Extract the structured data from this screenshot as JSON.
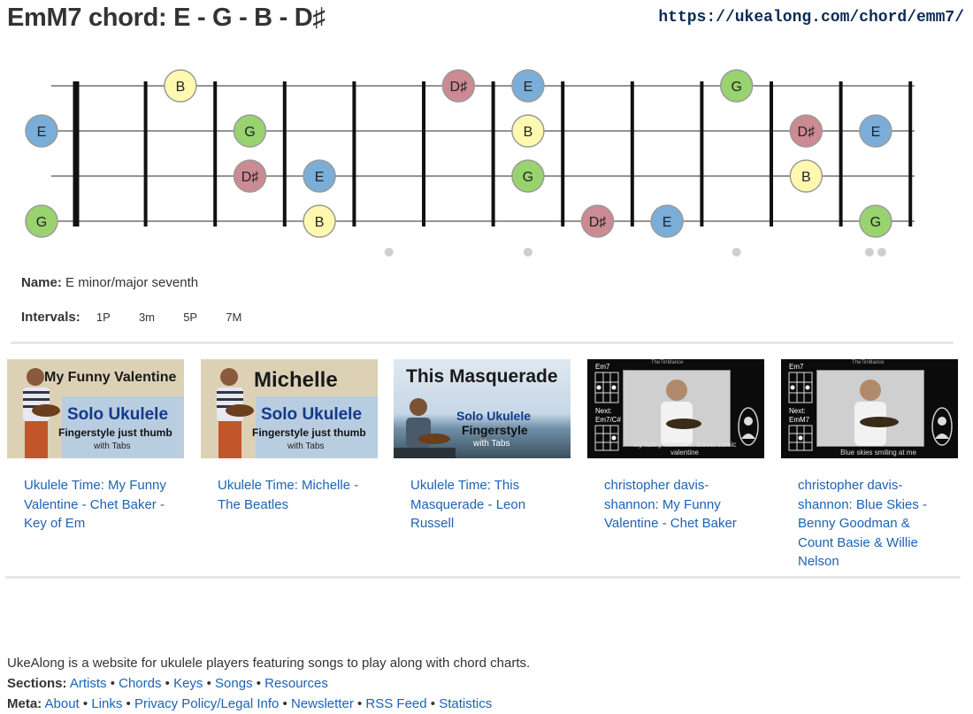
{
  "header": {
    "title": "EmM7 chord: E - G - B - D♯",
    "url": "https://ukealong.com/chord/emm7/"
  },
  "fretboard": {
    "notes": [
      {
        "string": 0,
        "fret": 2,
        "label": "B",
        "color": "#fff9b0"
      },
      {
        "string": 0,
        "fret": 6,
        "label": "D♯",
        "color": "#cc8a92"
      },
      {
        "string": 0,
        "fret": 7,
        "label": "E",
        "color": "#7aaed8"
      },
      {
        "string": 0,
        "fret": 10,
        "label": "G",
        "color": "#99d36f"
      },
      {
        "string": 1,
        "fret": 0,
        "label": "E",
        "color": "#7aaed8"
      },
      {
        "string": 1,
        "fret": 3,
        "label": "G",
        "color": "#99d36f"
      },
      {
        "string": 1,
        "fret": 7,
        "label": "B",
        "color": "#fff9b0"
      },
      {
        "string": 1,
        "fret": 11,
        "label": "D♯",
        "color": "#cc8a92"
      },
      {
        "string": 1,
        "fret": 12,
        "label": "E",
        "color": "#7aaed8"
      },
      {
        "string": 2,
        "fret": 3,
        "label": "D♯",
        "color": "#cc8a92"
      },
      {
        "string": 2,
        "fret": 4,
        "label": "E",
        "color": "#7aaed8"
      },
      {
        "string": 2,
        "fret": 7,
        "label": "G",
        "color": "#99d36f"
      },
      {
        "string": 2,
        "fret": 11,
        "label": "B",
        "color": "#fff9b0"
      },
      {
        "string": 3,
        "fret": 0,
        "label": "G",
        "color": "#99d36f"
      },
      {
        "string": 3,
        "fret": 4,
        "label": "B",
        "color": "#fff9b0"
      },
      {
        "string": 3,
        "fret": 8,
        "label": "D♯",
        "color": "#cc8a92"
      },
      {
        "string": 3,
        "fret": 9,
        "label": "E",
        "color": "#7aaed8"
      },
      {
        "string": 3,
        "fret": 12,
        "label": "G",
        "color": "#99d36f"
      }
    ],
    "markers": [
      5,
      7,
      10
    ],
    "double_marker": 12
  },
  "info": {
    "name_label": "Name:",
    "name_value": "E minor/major seventh",
    "intervals_label": "Intervals:",
    "intervals": [
      "1P",
      "3m",
      "5P",
      "7M"
    ]
  },
  "videos": [
    {
      "link": "Ukulele Time: My Funny Valentine - Chet Baker - Key of Em",
      "thumb_title": "My Funny Valentine",
      "solo": "Solo Ukulele",
      "sub": "Fingerstyle just thumb",
      "tabs": "with Tabs"
    },
    {
      "link": "Ukulele Time: Michelle - The Beatles",
      "thumb_title": "Michelle",
      "solo": "Solo Ukulele",
      "sub": "Fingerstyle just thumb",
      "tabs": "with Tabs"
    },
    {
      "link": "Ukulele Time: This Masquerade - Leon Russell",
      "thumb_title": "This Masquerade",
      "solo": "Solo Ukulele",
      "sub": "Fingerstyle",
      "tabs": "with Tabs"
    },
    {
      "link": "christopher davis-shannon: My Funny Valentine - Chet Baker",
      "chord_top": "Em7",
      "next": "Next:",
      "chord_bottom": "Em7/C#",
      "caption": "My funny valentine. Sweet comic valentine",
      "brand": "TheTinMance"
    },
    {
      "link": "christopher davis-shannon: Blue Skies - Benny Goodman & Count Basie & Willie Nelson",
      "chord_top": "Em7",
      "next": "Next:",
      "chord_bottom": "EmM7",
      "caption": "Blue skies smiling at me",
      "brand": "TheTinMance"
    }
  ],
  "footer": {
    "about_text": "UkeAlong is a website for ukulele players featuring songs to play along with chord charts.",
    "sections_label": "Sections:",
    "sections": [
      "Artists",
      "Chords",
      "Keys",
      "Songs",
      "Resources"
    ],
    "meta_label": "Meta:",
    "meta": [
      "About",
      "Links",
      "Privacy Policy/Legal Info",
      "Newsletter",
      "RSS Feed",
      "Statistics"
    ]
  }
}
